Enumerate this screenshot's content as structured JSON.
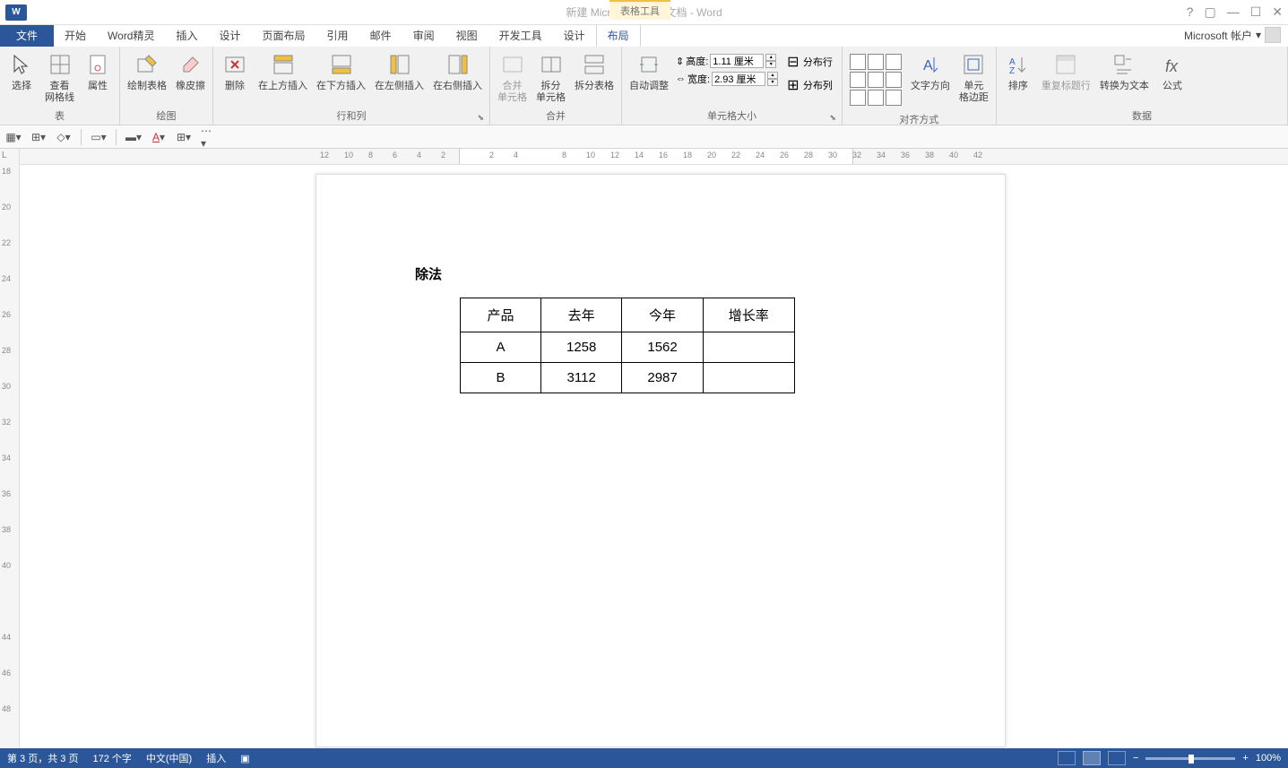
{
  "titlebar": {
    "doc_title": "新建 Microsoft Word 文档 - Word",
    "context_tab": "表格工具",
    "help": "?",
    "account_label": "Microsoft 帐户"
  },
  "tabs": {
    "file": "文件",
    "items": [
      "开始",
      "Word精灵",
      "插入",
      "设计",
      "页面布局",
      "引用",
      "邮件",
      "审阅",
      "视图",
      "开发工具",
      "设计",
      "布局"
    ]
  },
  "ribbon": {
    "group_table": "表",
    "select": "选择",
    "view_gridlines": "查看\n网格线",
    "properties": "属性",
    "group_draw": "绘图",
    "draw_table": "绘制表格",
    "eraser": "橡皮擦",
    "delete": "删除",
    "group_rowcol": "行和列",
    "insert_above": "在上方插入",
    "insert_below": "在下方插入",
    "insert_left": "在左侧插入",
    "insert_right": "在右侧插入",
    "group_merge": "合并",
    "merge_cells": "合并\n单元格",
    "split_cells": "拆分\n单元格",
    "split_table": "拆分表格",
    "autofit": "自动调整",
    "group_cellsize": "单元格大小",
    "height_label": "高度:",
    "height_value": "1.11 厘米",
    "width_label": "宽度:",
    "width_value": "2.93 厘米",
    "dist_rows": "分布行",
    "dist_cols": "分布列",
    "group_align": "对齐方式",
    "text_direction": "文字方向",
    "cell_margins": "单元\n格边距",
    "group_data": "数据",
    "sort": "排序",
    "repeat_header": "重复标题行",
    "convert_text": "转换为文本",
    "formula": "公式"
  },
  "ruler": {
    "h_ticks": [
      "12",
      "10",
      "8",
      "6",
      "4",
      "2",
      "",
      "2",
      "4",
      "",
      "8",
      "10",
      "12",
      "14",
      "16",
      "18",
      "20",
      "22",
      "24",
      "26",
      "28",
      "30",
      "32",
      "34",
      "36",
      "38",
      "40",
      "42"
    ],
    "v_ticks": [
      "18",
      "20",
      "22",
      "24",
      "26",
      "28",
      "30",
      "32",
      "34",
      "36",
      "38",
      "40",
      "",
      "44",
      "46",
      "48"
    ]
  },
  "document": {
    "heading": "除法",
    "table": {
      "headers": [
        "产品",
        "去年",
        "今年",
        "增长率"
      ],
      "rows": [
        [
          "A",
          "1258",
          "1562",
          ""
        ],
        [
          "B",
          "3112",
          "2987",
          ""
        ]
      ]
    }
  },
  "statusbar": {
    "page_info": "第 3 页，共 3 页",
    "word_count": "172 个字",
    "language": "中文(中国)",
    "mode": "插入",
    "zoom": "100%"
  }
}
